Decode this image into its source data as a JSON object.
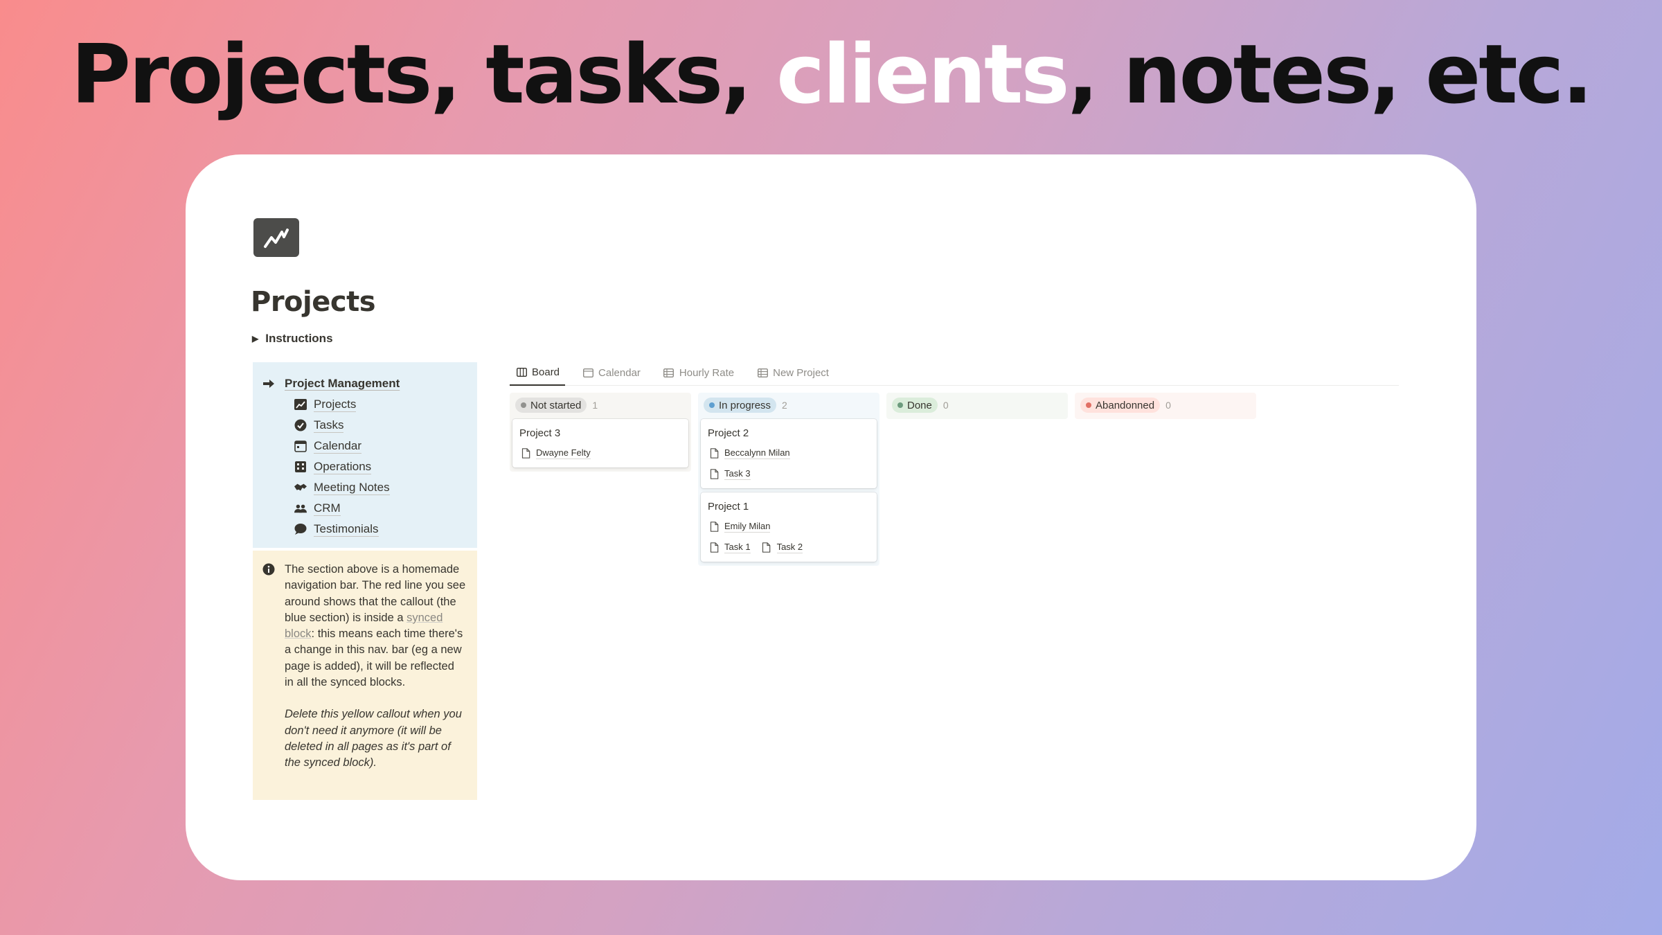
{
  "headline": {
    "part1": "Projects, tasks, ",
    "highlight": "clients",
    "part2": ", notes, etc."
  },
  "page": {
    "title": "Projects",
    "toggle_label": "Instructions"
  },
  "nav": {
    "header": "Project Management",
    "items": [
      {
        "label": "Projects",
        "icon": "chart-icon"
      },
      {
        "label": "Tasks",
        "icon": "check-circle-icon"
      },
      {
        "label": "Calendar",
        "icon": "calendar-icon"
      },
      {
        "label": "Operations",
        "icon": "building-icon"
      },
      {
        "label": "Meeting Notes",
        "icon": "handshake-icon"
      },
      {
        "label": "CRM",
        "icon": "people-icon"
      },
      {
        "label": "Testimonials",
        "icon": "speech-bubble-icon"
      }
    ]
  },
  "note": {
    "p1_a": "The section above is a homemade navigation bar. The red line you see around shows that the callout (the blue section) is inside a ",
    "p1_link": "synced block",
    "p1_b": ": this means each time there's a change in this nav. bar (eg a new page is added), it will be reflected in all the synced blocks.",
    "p2": "Delete this yellow callout when you don't need it anymore (it will be deleted in all pages as it's part of the synced block)."
  },
  "views": {
    "tabs": [
      "Board",
      "Calendar",
      "Hourly Rate",
      "New Project"
    ],
    "active": "Board"
  },
  "board": {
    "columns": [
      {
        "status": "Not started",
        "count": "1",
        "color": "#91918e",
        "pill_bg": "#e3e2e0",
        "col_bg": "#f7f6f3",
        "cards": [
          {
            "title": "Project 3",
            "relations": [
              [
                "Dwayne Felty"
              ]
            ]
          }
        ]
      },
      {
        "status": "In progress",
        "count": "2",
        "color": "#5e9fd0",
        "pill_bg": "#d3e5ef",
        "col_bg": "#f3f8fb",
        "cards": [
          {
            "title": "Project 2",
            "relations": [
              [
                "Beccalynn Milan"
              ],
              [
                "Task 3"
              ]
            ]
          },
          {
            "title": "Project 1",
            "relations": [
              [
                "Emily Milan"
              ],
              [
                "Task 1",
                "Task 2"
              ]
            ]
          }
        ]
      },
      {
        "status": "Done",
        "count": "0",
        "color": "#6c9b7d",
        "pill_bg": "#dbeddb",
        "col_bg": "#f5f8f4",
        "cards": []
      },
      {
        "status": "Abandonned",
        "count": "0",
        "color": "#e16f64",
        "pill_bg": "#ffe2dd",
        "col_bg": "#fdf5f3",
        "cards": []
      }
    ]
  }
}
